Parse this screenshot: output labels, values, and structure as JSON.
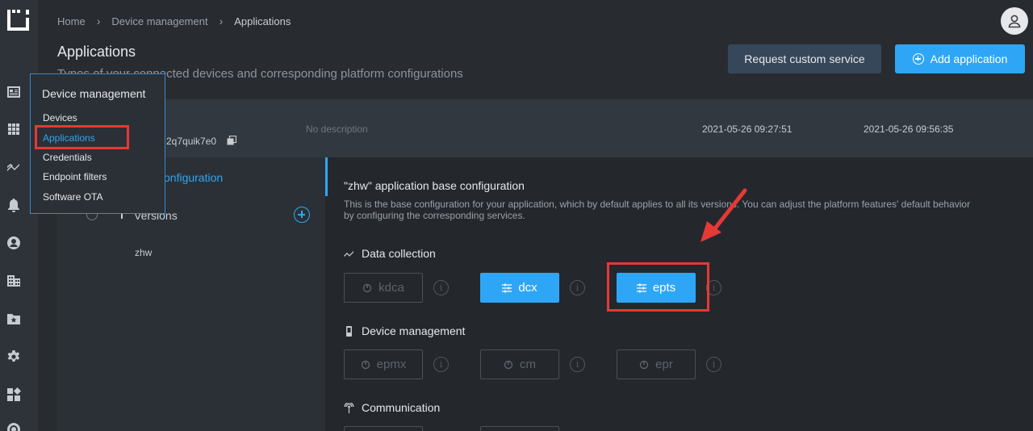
{
  "breadcrumb": {
    "home": "Home",
    "device_management": "Device management",
    "current": "Applications"
  },
  "page": {
    "title": "Applications",
    "subtitle": "Types of your connected devices and corresponding platform configurations"
  },
  "actions": {
    "request_custom_service": "Request custom service",
    "add_application": "Add application"
  },
  "app_row": {
    "id": "2q7quik7e0",
    "description": "No description",
    "created": "2021-05-26 09:27:51",
    "updated": "2021-05-26 09:56:35"
  },
  "left_panel": {
    "base_config": "onfiguration",
    "versions": "Versions",
    "version_items": [
      "zhw"
    ]
  },
  "config": {
    "title": "\"zhw\" application base configuration",
    "description": "This is the base configuration for your application, which by default applies to all its versions. You can adjust the platform features' default behavior by configuring the corresponding services.",
    "info_glyph": "i",
    "sections": [
      {
        "title": "Data collection",
        "icon": "trend-icon",
        "services": [
          {
            "name": "kdca",
            "enabled": false
          },
          {
            "name": "dcx",
            "enabled": true
          },
          {
            "name": "epts",
            "enabled": true
          }
        ]
      },
      {
        "title": "Device management",
        "icon": "phone-icon",
        "services": [
          {
            "name": "epmx",
            "enabled": false
          },
          {
            "name": "cm",
            "enabled": false
          },
          {
            "name": "epr",
            "enabled": false
          }
        ]
      },
      {
        "title": "Communication",
        "icon": "antenna-icon",
        "services": []
      }
    ]
  },
  "dropdown": {
    "title": "Device management",
    "items": [
      "Devices",
      "Applications",
      "Credentials",
      "Endpoint filters",
      "Software OTA"
    ],
    "active_index": 1
  },
  "colors": {
    "accent": "#2fa6f5",
    "annotation": "#e53935"
  }
}
